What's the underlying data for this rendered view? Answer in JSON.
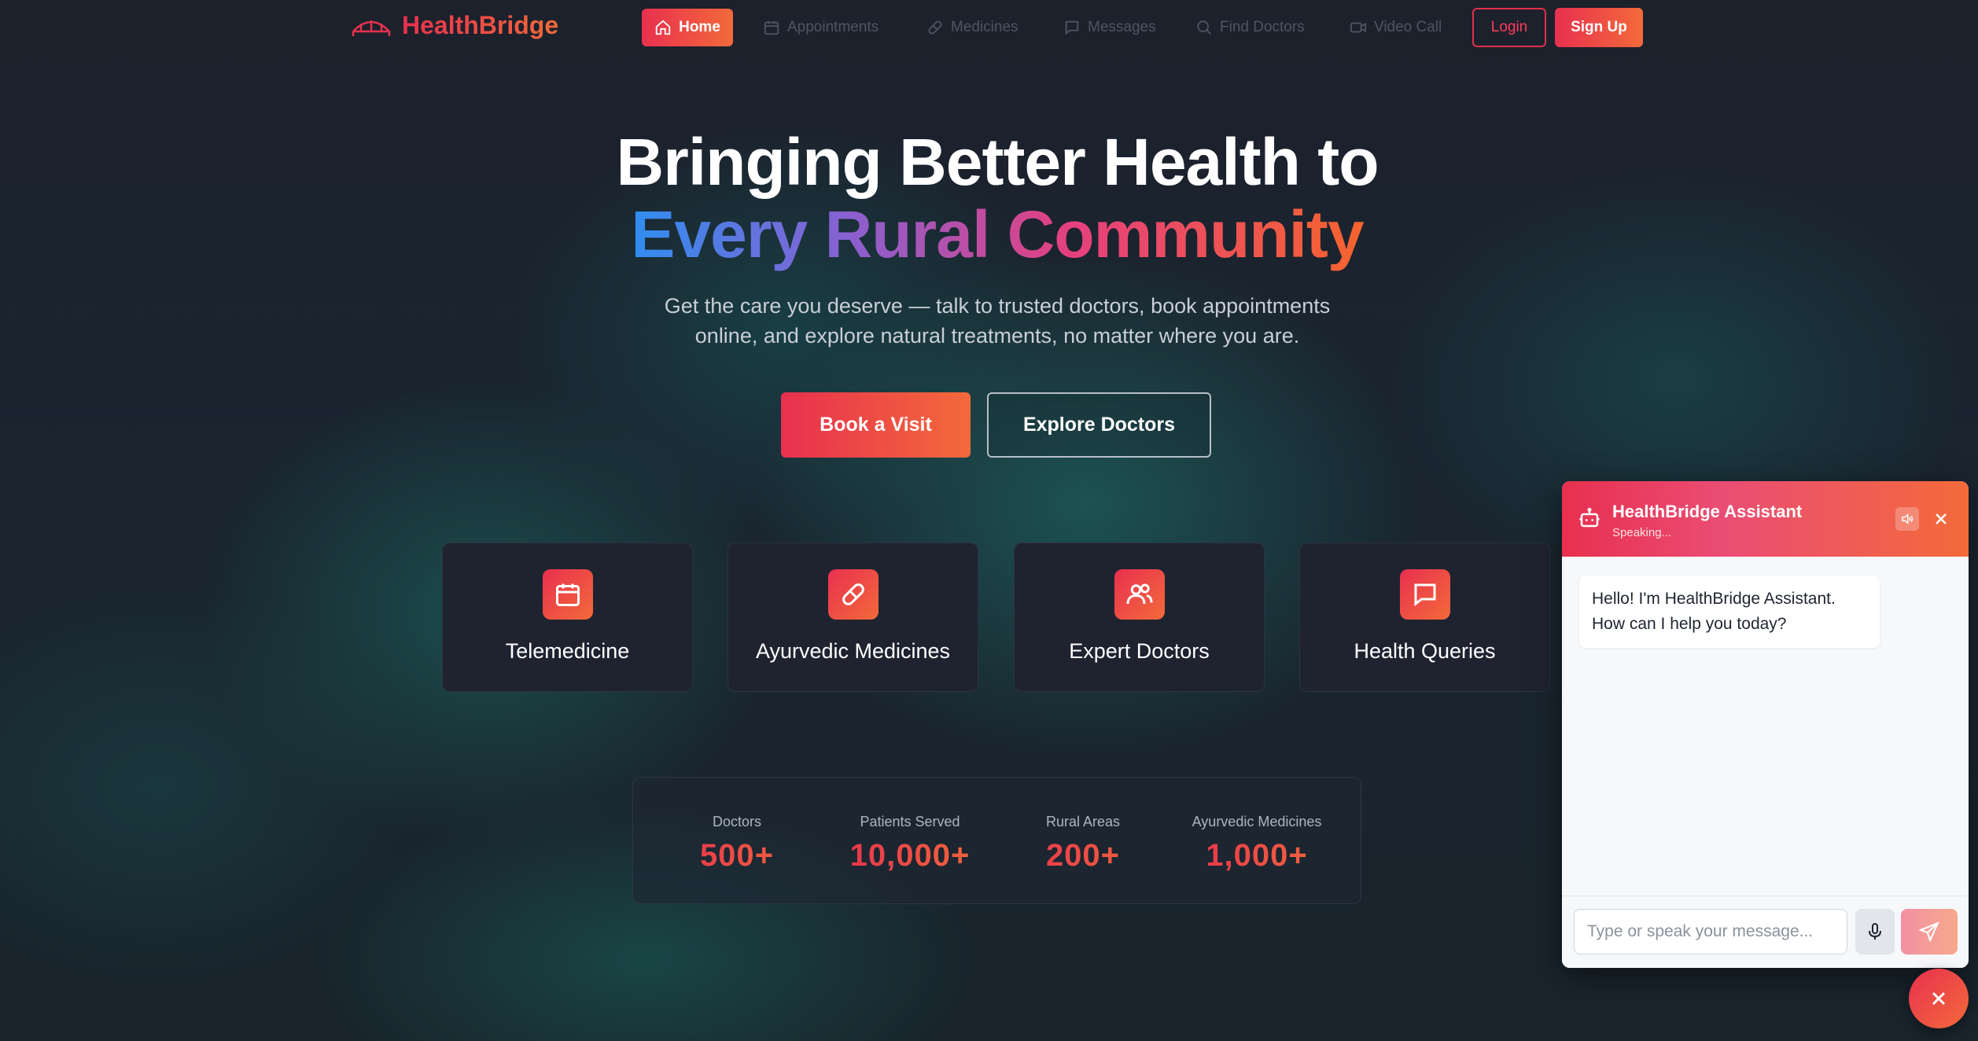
{
  "brand": {
    "name": "HealthBridge"
  },
  "nav": {
    "items": [
      {
        "label": "Home",
        "icon": "home-icon",
        "active": true
      },
      {
        "label": "Appointments",
        "icon": "calendar-icon"
      },
      {
        "label": "Medicines",
        "icon": "pill-icon"
      },
      {
        "label": "Messages",
        "icon": "message-icon"
      },
      {
        "label": "Find Doctors",
        "icon": "search-icon"
      },
      {
        "label": "Video Call",
        "icon": "video-icon"
      }
    ],
    "login_label": "Login",
    "signup_label": "Sign Up"
  },
  "hero": {
    "title_line1": "Bringing Better Health to",
    "title_line2": "Every Rural Community",
    "subtitle": "Get the care you deserve — talk to trusted doctors, book appointments online, and explore natural treatments, no matter where you are.",
    "cta_primary": "Book a Visit",
    "cta_secondary": "Explore Doctors"
  },
  "features": [
    {
      "label": "Telemedicine",
      "icon": "calendar-icon"
    },
    {
      "label": "Ayurvedic Medicines",
      "icon": "pill-icon"
    },
    {
      "label": "Expert Doctors",
      "icon": "users-icon"
    },
    {
      "label": "Health Queries",
      "icon": "message-icon"
    }
  ],
  "stats": [
    {
      "label": "Doctors",
      "value": "500+"
    },
    {
      "label": "Patients Served",
      "value": "10,000+"
    },
    {
      "label": "Rural Areas",
      "value": "200+"
    },
    {
      "label": "Ayurvedic Medicines",
      "value": "1,000+"
    }
  ],
  "chat": {
    "title": "HealthBridge Assistant",
    "status": "Speaking...",
    "greeting": "Hello! I'm HealthBridge Assistant. How can I help you today?",
    "input_placeholder": "Type or speak your message..."
  },
  "colors": {
    "accent_start": "#e8304f",
    "accent_end": "#f36a3a",
    "background": "#1b1f2a"
  }
}
